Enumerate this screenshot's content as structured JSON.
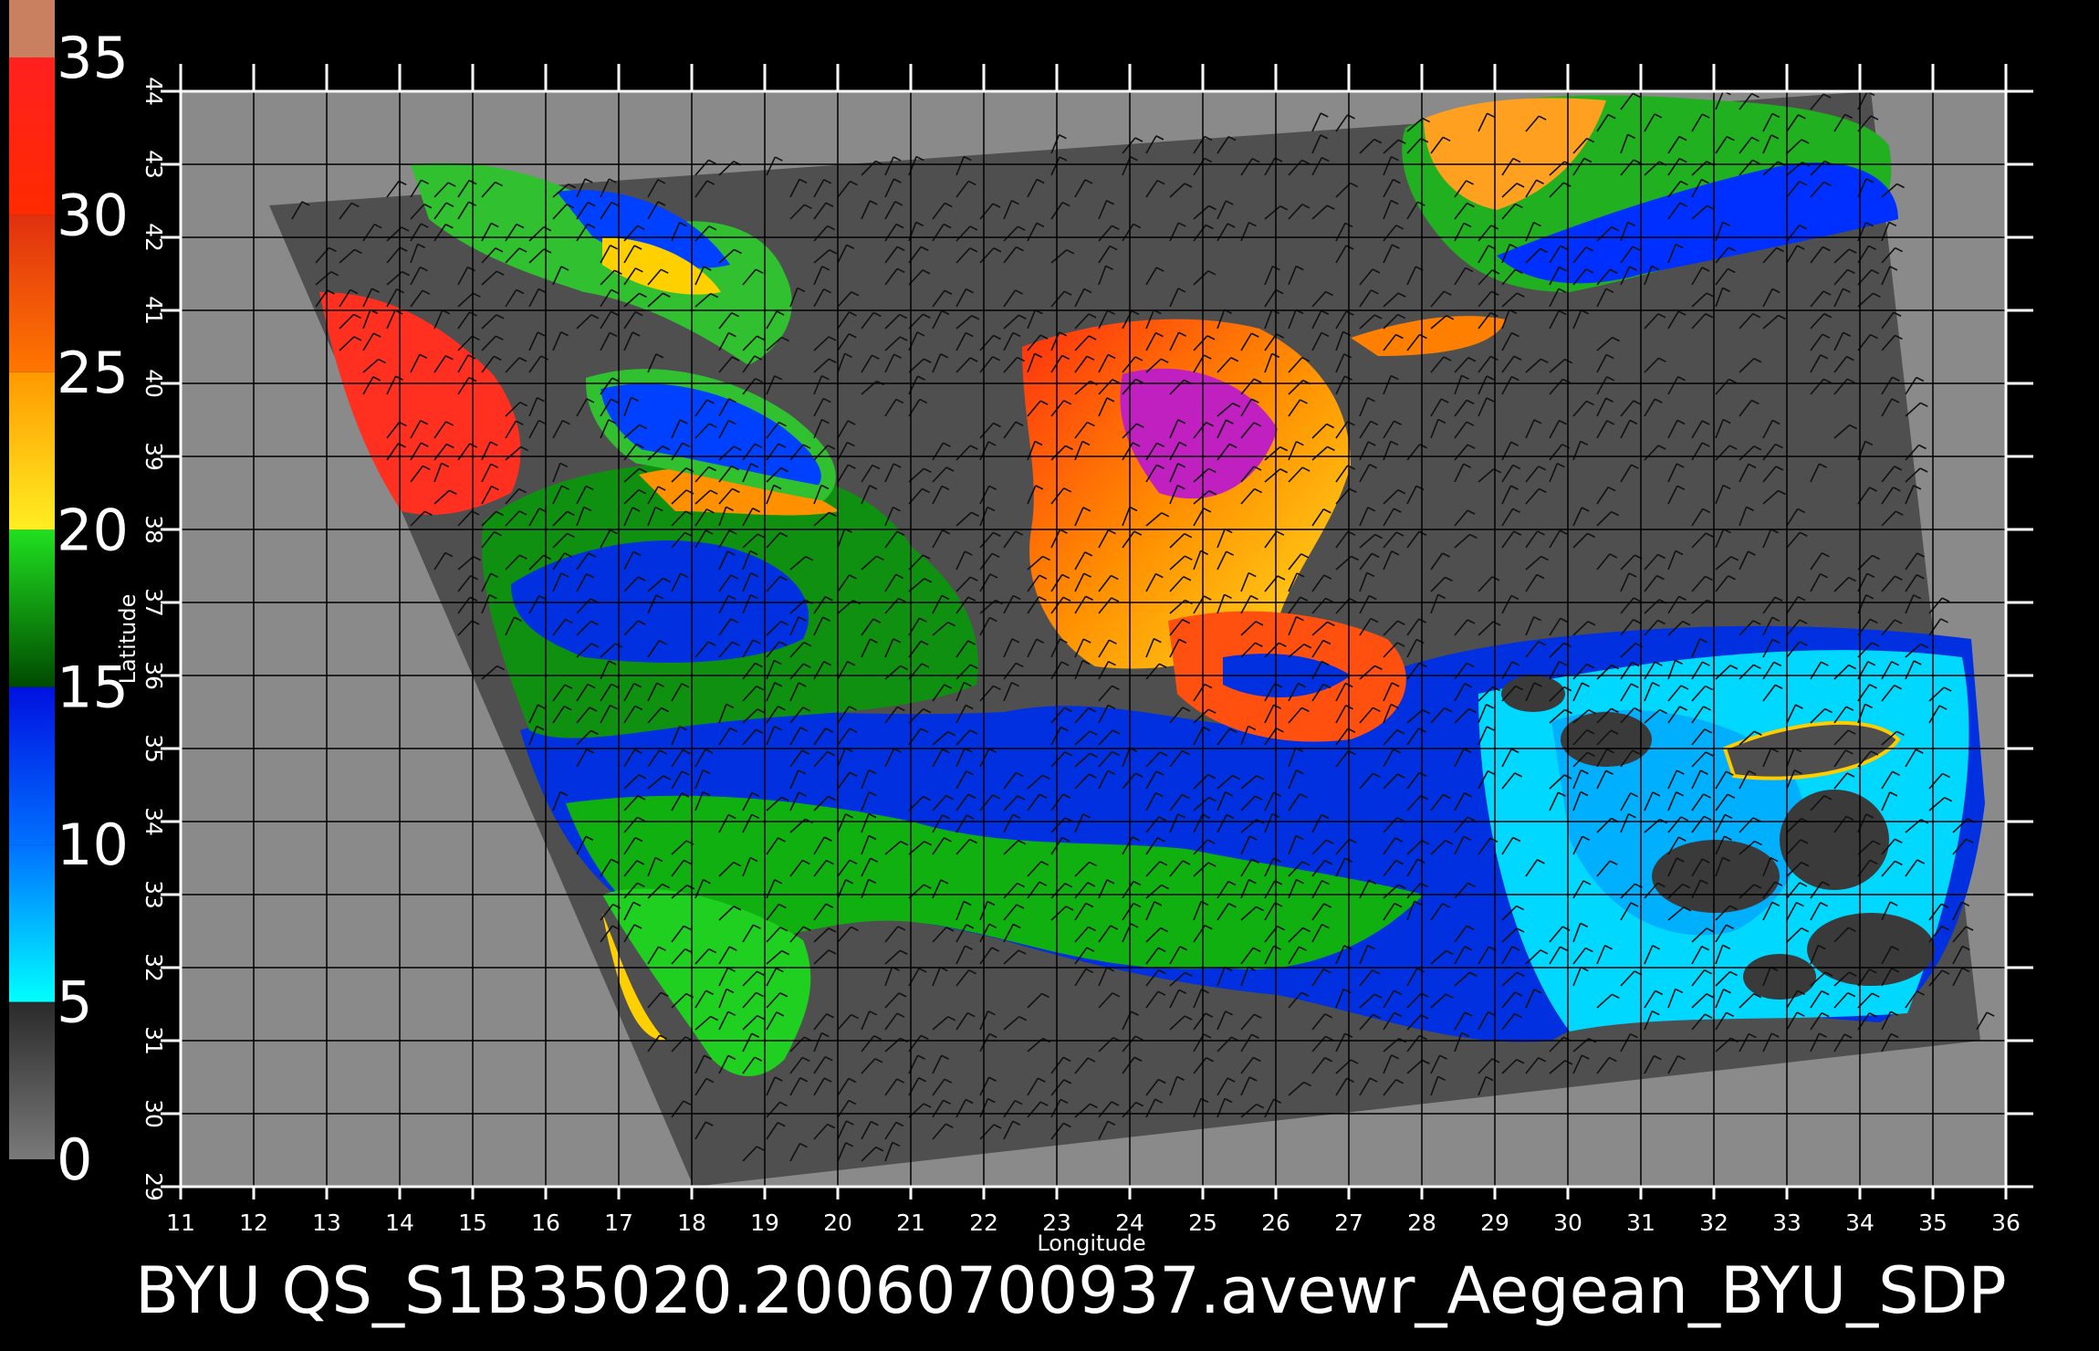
{
  "map": {
    "caption": "BYU  QS_S1B35020.20060700937.avewr_Aegean_BYU_SDP",
    "x_axis_title": "Longitude",
    "y_axis_title": "Latitude",
    "lon_range": [
      11,
      36
    ],
    "lat_range": [
      29,
      44
    ],
    "lon_ticks": [
      "11",
      "12",
      "13",
      "14",
      "15",
      "16",
      "17",
      "18",
      "19",
      "20",
      "21",
      "22",
      "23",
      "24",
      "25",
      "26",
      "27",
      "28",
      "29",
      "30",
      "31",
      "32",
      "33",
      "34",
      "35",
      "36"
    ],
    "lat_ticks": [
      "29",
      "30",
      "31",
      "32",
      "33",
      "34",
      "35",
      "36",
      "37",
      "38",
      "39",
      "40",
      "41",
      "42",
      "43",
      "44"
    ],
    "colors": {
      "background": "#000000",
      "no_data": "#8a8a8a",
      "swath": "#4f4f4f",
      "grid": "#000000",
      "wind_barb": "#111111"
    }
  },
  "color_scale": {
    "title": "",
    "labels": [
      "0",
      "5",
      "10",
      "15",
      "20",
      "25",
      "30",
      "35"
    ],
    "values": [
      0,
      5,
      10,
      15,
      20,
      25,
      30,
      35
    ],
    "bands": [
      {
        "from": 0,
        "to": 5,
        "colors": [
          "#7a7a7a",
          "#2a2a2a"
        ]
      },
      {
        "from": 5,
        "to": 10,
        "colors": [
          "#00ffff",
          "#0070ff"
        ]
      },
      {
        "from": 10,
        "to": 15,
        "colors": [
          "#0070ff",
          "#0010e0"
        ]
      },
      {
        "from": 15,
        "to": 20,
        "colors": [
          "#004a00",
          "#20e020"
        ]
      },
      {
        "from": 20,
        "to": 25,
        "colors": [
          "#ffee22",
          "#ff9900"
        ]
      },
      {
        "from": 25,
        "to": 30,
        "colors": [
          "#ff7700",
          "#e03010"
        ]
      },
      {
        "from": 30,
        "to": 35,
        "colors": [
          "#ff2a00",
          "#ff2020"
        ]
      },
      {
        "from": 35,
        "to": 37,
        "colors": [
          "#c88060",
          "#c88060"
        ]
      }
    ]
  }
}
